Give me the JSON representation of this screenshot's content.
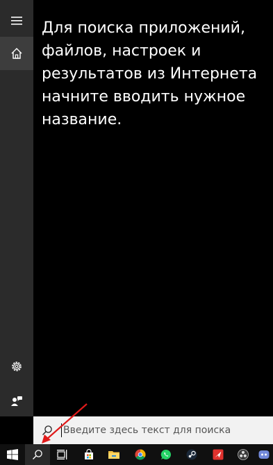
{
  "start_panel": {
    "hint_text": "Для поиска приложений, файлов, настроек и результатов из Интернета начните вводить нужное название."
  },
  "search": {
    "placeholder": "Введите здесь текст для поиска"
  },
  "sidebar": {
    "items": [
      {
        "icon": "hamburger-menu-icon"
      },
      {
        "icon": "home-icon"
      },
      {
        "icon": "gear-icon"
      },
      {
        "icon": "feedback-icon"
      }
    ]
  },
  "taskbar": {
    "items": [
      {
        "icon": "windows-start-icon"
      },
      {
        "icon": "search-icon"
      },
      {
        "icon": "task-view-icon"
      },
      {
        "icon": "store-icon"
      },
      {
        "icon": "file-explorer-icon"
      },
      {
        "icon": "chrome-icon"
      },
      {
        "icon": "whatsapp-icon"
      },
      {
        "icon": "steam-icon"
      },
      {
        "icon": "red-app-icon"
      },
      {
        "icon": "obs-icon"
      },
      {
        "icon": "discord-icon"
      }
    ]
  },
  "colors": {
    "sidebar_bg": "#2b2b2b",
    "panel_bg": "#000000",
    "search_bg": "#f2f2f2",
    "taskbar_bg": "#101010",
    "annotation_arrow": "#e01b1b"
  }
}
